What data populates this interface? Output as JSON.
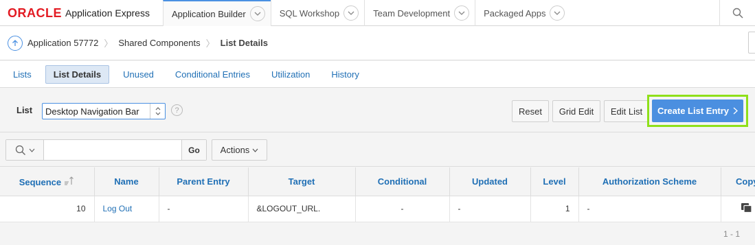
{
  "header": {
    "brand": "ORACLE",
    "product": "Application Express",
    "tabs": [
      {
        "label": "Application Builder"
      },
      {
        "label": "SQL Workshop"
      },
      {
        "label": "Team Development"
      },
      {
        "label": "Packaged Apps"
      }
    ]
  },
  "breadcrumb": {
    "items": [
      "Application 57772",
      "Shared Components",
      "List Details"
    ]
  },
  "subtabs": [
    "Lists",
    "List Details",
    "Unused",
    "Conditional Entries",
    "Utilization",
    "History"
  ],
  "list_selector": {
    "label": "List",
    "value": "Desktop Navigation Bar",
    "help": "?"
  },
  "buttons": {
    "reset": "Reset",
    "grid_edit": "Grid Edit",
    "edit_list": "Edit List",
    "create": "Create List Entry"
  },
  "search": {
    "value": "",
    "go": "Go",
    "actions": "Actions"
  },
  "table": {
    "columns": [
      "Sequence",
      "Name",
      "Parent Entry",
      "Target",
      "Conditional",
      "Updated",
      "Level",
      "Authorization Scheme",
      "Copy"
    ],
    "rows": [
      {
        "sequence": "10",
        "name": "Log Out",
        "parent": "-",
        "target": "&LOGOUT_URL.",
        "conditional": "-",
        "updated": "-",
        "level": "1",
        "auth": "-"
      }
    ],
    "pagination": "1 - 1"
  },
  "colors": {
    "accent": "#4a90e2",
    "highlight": "#8fe01a",
    "oracle_red": "#e31b23"
  }
}
